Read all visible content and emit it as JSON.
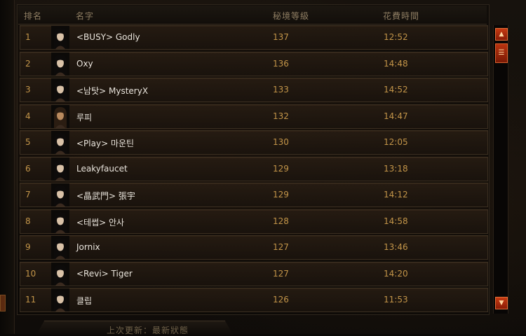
{
  "header": {
    "rank": "排名",
    "name": "名字",
    "level": "秘境等級",
    "time": "花費時間"
  },
  "rows": [
    {
      "rank": "1",
      "name": "<BUSY> Godly",
      "level": "137",
      "time": "12:52",
      "avatar": "female-hero-portrait"
    },
    {
      "rank": "2",
      "name": "Oxy",
      "level": "136",
      "time": "14:48",
      "avatar": "female-hero-portrait"
    },
    {
      "rank": "3",
      "name": "<남탓> MysteryX",
      "level": "133",
      "time": "14:52",
      "avatar": "female-hero-portrait"
    },
    {
      "rank": "4",
      "name": "루피",
      "level": "132",
      "time": "14:47",
      "avatar": "male-hero-portrait"
    },
    {
      "rank": "5",
      "name": "<Play> 마운틴",
      "level": "130",
      "time": "12:05",
      "avatar": "female-hero-portrait"
    },
    {
      "rank": "6",
      "name": "Leakyfaucet",
      "level": "129",
      "time": "13:18",
      "avatar": "female-hero-portrait"
    },
    {
      "rank": "7",
      "name": "<晶武門> 張宇",
      "level": "129",
      "time": "14:12",
      "avatar": "female-hero-portrait"
    },
    {
      "rank": "8",
      "name": "<테썹> 안사",
      "level": "128",
      "time": "14:58",
      "avatar": "female-hero-portrait"
    },
    {
      "rank": "9",
      "name": "Jornix",
      "level": "127",
      "time": "13:46",
      "avatar": "female-hero-portrait"
    },
    {
      "rank": "10",
      "name": "<Revi> Tiger",
      "level": "127",
      "time": "14:20",
      "avatar": "female-hero-portrait"
    },
    {
      "rank": "11",
      "name": "클립",
      "level": "126",
      "time": "11:53",
      "avatar": "female-hero-portrait"
    }
  ],
  "scrollbar": {
    "up_glyph": "▲",
    "down_glyph": "▼",
    "thumb_glyph": "☰"
  },
  "footer": {
    "last_update": "上次更新：最新狀態"
  },
  "colors": {
    "accent_gold": "#c39549",
    "name_text": "#e9e4dc",
    "scroll_red": "#b8330f"
  }
}
